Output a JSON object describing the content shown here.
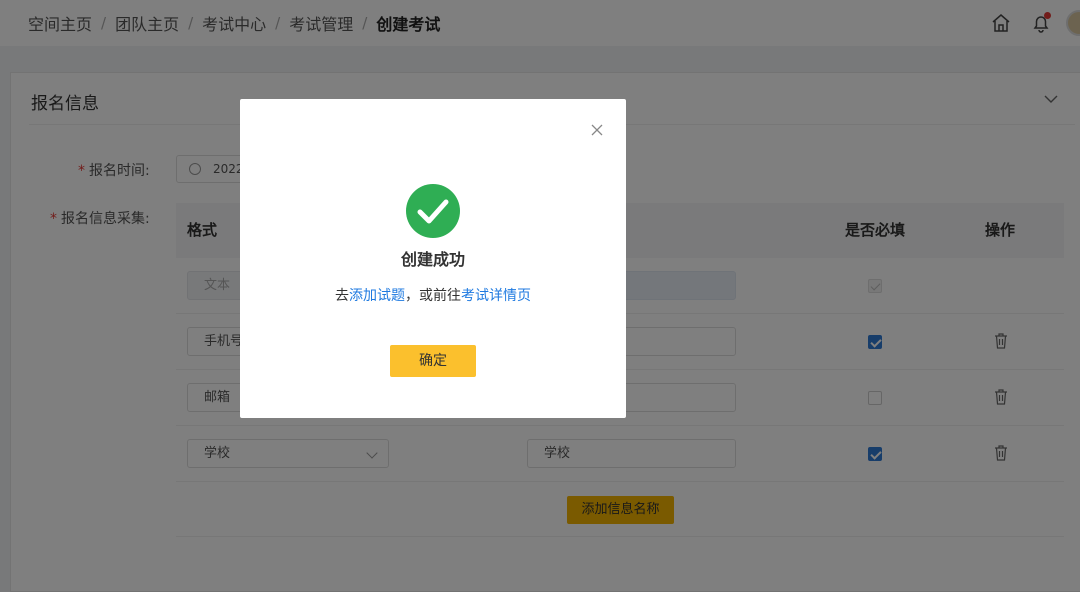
{
  "breadcrumb": {
    "items": [
      "空间主页",
      "团队主页",
      "考试中心",
      "考试管理"
    ],
    "current": "创建考试",
    "separator": "/"
  },
  "header_icons": [
    "home-icon",
    "bell-icon",
    "avatar"
  ],
  "section": {
    "title": "报名信息"
  },
  "form": {
    "signup_time_label": "报名时间:",
    "signup_time_value": "2022",
    "collect_label": "报名信息采集:"
  },
  "table": {
    "columns": [
      "格式",
      "是否必填",
      "操作"
    ],
    "rows": [
      {
        "format": "文本",
        "name": "",
        "required": true,
        "disabled": true,
        "deletable": false
      },
      {
        "format": "手机号",
        "name": "",
        "required": true,
        "disabled": false,
        "deletable": true
      },
      {
        "format": "邮箱",
        "name": "",
        "required": false,
        "disabled": false,
        "deletable": true
      },
      {
        "format": "学校",
        "name": "学校",
        "required": true,
        "disabled": false,
        "deletable": true
      }
    ],
    "add_button": "添加信息名称"
  },
  "modal": {
    "title": "创建成功",
    "msg_prefix": "去",
    "link_add_questions": "添加试题",
    "msg_middle": "，或前往",
    "link_exam_detail": "考试详情页",
    "confirm": "确定"
  },
  "colors": {
    "accent": "#fbc02d",
    "success": "#2fae54",
    "link": "#1f7ae0",
    "checkbox": "#2f7ad5"
  }
}
